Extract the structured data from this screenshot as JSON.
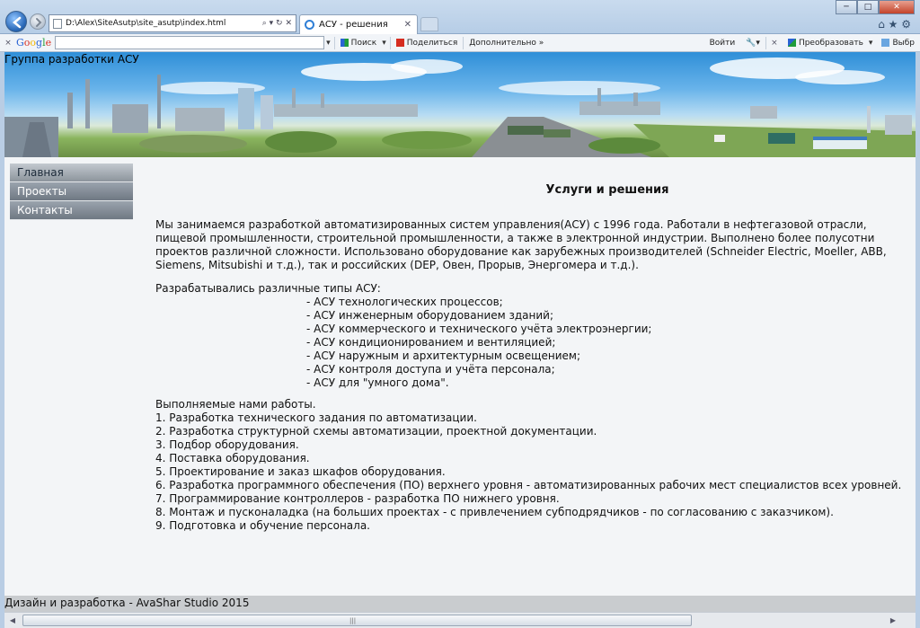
{
  "browser": {
    "address_url": "D:\\Alex\\SiteAsutp\\site_asutp\\index.html",
    "address_tools": "⌕ ▾ ↻ ✕",
    "tab_title": "АСУ - решения",
    "tab_close": "✕",
    "window_controls": {
      "minimize": "─",
      "maximize": "□",
      "close": "✕"
    },
    "fav_icons": "⌂ ★ ⚙"
  },
  "google_toolbar": {
    "close": "×",
    "logo": "Google",
    "search_value": "",
    "dropdown_arrow": "▾",
    "search_label": "Поиск",
    "share_label": "Поделиться",
    "more_label": "Дополнительно »",
    "signin_label": "Войти",
    "translate_label": "Преобразовать",
    "select_label": "Выбр",
    "colors": {
      "g_blue": "#2a63d4",
      "g_red": "#d62d20",
      "g_yellow": "#f2b600",
      "g_green": "#1f9c3a"
    }
  },
  "site": {
    "title": "Группа разработки АСУ",
    "menu": [
      {
        "label": "Главная"
      },
      {
        "label": "Проекты"
      },
      {
        "label": "Контакты"
      }
    ],
    "heading": "Услуги и решения",
    "intro": "Мы занимаемся разработкой автоматизированных систем управления(АСУ) с 1996 года. Работали в нефтегазовой отрасли, пищевой промышленности, строительной промышленности, а также в электронной индустрии. Выполнено более полусотни проектов различной сложности. Использовано оборудование как зарубежных производителей (Schneider Electric, Moeller, ABB, Siemens, Mitsubishi и т.д.), так и российских (DEP, Овен, Прорыв, Энергомера и т.д.).",
    "types_heading": "Разрабатывались различные типы АСУ:",
    "types": [
      "- АСУ технологических процессов;",
      "- АСУ инженерным оборудованием зданий;",
      "- АСУ коммерческого и технического учёта электроэнергии;",
      "- АСУ кондиционированием и вентиляцией;",
      "- АСУ наружным и архитектурным освещением;",
      "- АСУ контроля доступа и учёта персонала;",
      "- АСУ для \"умного дома\"."
    ],
    "works_heading": "Выполняемые нами работы.",
    "works": [
      "1. Разработка технического задания по автоматизации.",
      "2. Разработка структурной схемы автоматизации, проектной документации.",
      "3. Подбор оборудования.",
      "4. Поставка оборудования.",
      "5. Проектирование и заказ шкафов оборудования.",
      "6. Разработка программного обеспечения (ПО) верхнего уровня - автоматизированных рабочих мест специалистов всех уровней.",
      "7. Программирование контроллеров - разработка ПО нижнего уровня.",
      "8. Монтаж и пусконаладка (на больших проектах - с привлечением субподрядчиков - по согласованию с заказчиком).",
      "9. Подготовка и обучение персонала."
    ],
    "footer": "Дизайн и разработка - AvaShar Studio 2015"
  },
  "scrollbar": {
    "left_arrow": "◀",
    "right_arrow": "▶",
    "grip": "|||"
  }
}
